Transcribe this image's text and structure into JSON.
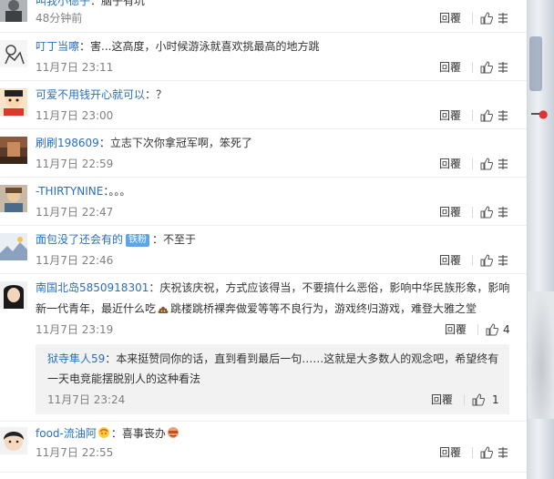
{
  "comments": [
    {
      "username": "叫我小德子",
      "text": "：脑子有坑",
      "time": "48分钟前",
      "reply": "回覆",
      "like_count": ""
    },
    {
      "username": "叮丁当嚓",
      "text": "：害...这高度，小时候游泳就喜欢挑最高的地方跳",
      "time": "11月7日 23:11",
      "reply": "回覆",
      "like_count": ""
    },
    {
      "username": "可爱不用钱开心就可以",
      "text": "：？",
      "time": "11月7日 23:00",
      "reply": "回覆",
      "like_count": ""
    },
    {
      "username": "刷刷198609",
      "text": "：立志下次你拿冠军啊，笨死了",
      "time": "11月7日 22:59",
      "reply": "回覆",
      "like_count": ""
    },
    {
      "username": "-THIRTYNINE",
      "text": "：。。。",
      "time": "11月7日 22:47",
      "reply": "回覆",
      "like_count": ""
    },
    {
      "username": "面包没了还会有的",
      "badge": "铁粉",
      "text": "：不至于",
      "time": "11月7日 22:46",
      "reply": "回覆",
      "like_count": ""
    },
    {
      "username": "南国北岛5850918301",
      "text_line1": "：庆祝该庆祝，方式应该得当，不要搞什么恶俗，影响中华民族形象，影响",
      "text_line2a": "新一代青年，最近什么吃",
      "text_line2b": "跳楼跳桥裸奔做爱等等不良行为，游戏终归游戏，难登大雅之堂",
      "time": "11月7日 23:19",
      "reply": "回覆",
      "like_count": "4",
      "subreply": {
        "username": "狱寺隼人59",
        "text_line1": "：本来挺赞同你的话，直到看到最后一句……这就是大多数人的观念吧，希望终有",
        "text_line2": "一天电竞能摆脱别人的这种看法",
        "time": "11月7日 23:24",
        "reply": "回覆",
        "like_count": "1"
      }
    },
    {
      "username": "food-流油阿",
      "text": "：喜事丧办",
      "time": "11月7日 22:55",
      "reply": "回覆",
      "like_count": ""
    }
  ],
  "colors": {
    "link": "#2a6fb8",
    "time": "#808080",
    "badge": "#5da5e8",
    "subreply_bg": "#f2f2f2"
  }
}
